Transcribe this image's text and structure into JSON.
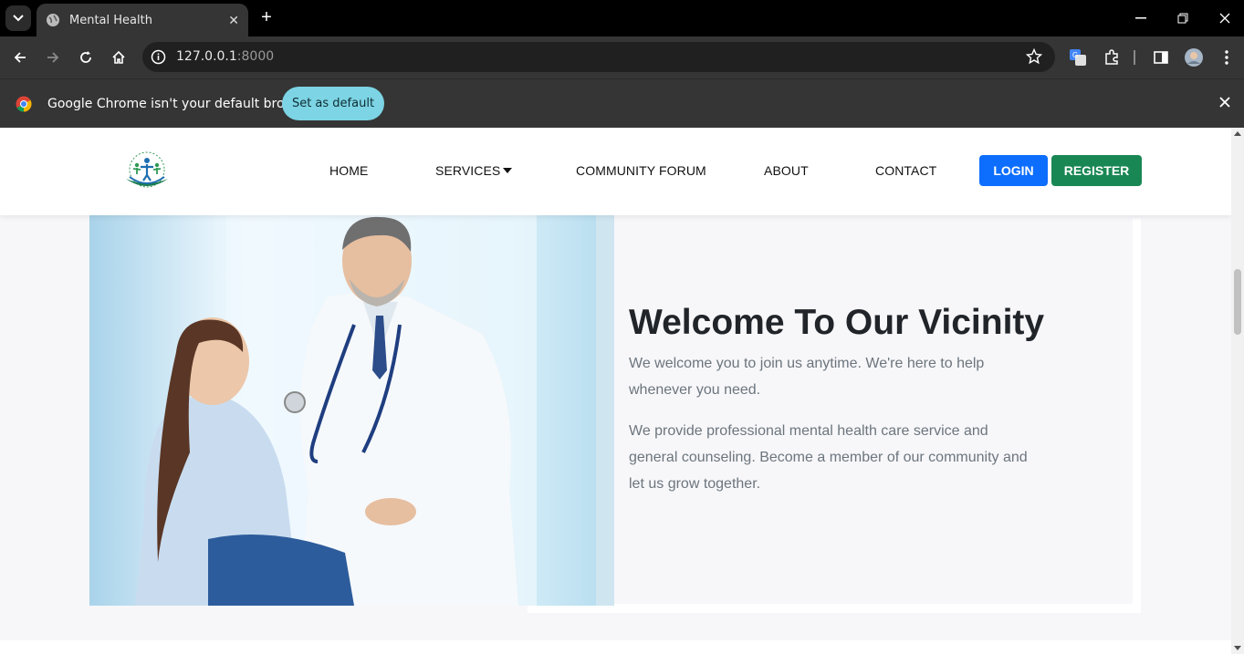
{
  "browser": {
    "tab_title": "Mental Health",
    "url_host": "127.0.0.1",
    "url_port": ":8000",
    "infobar_message": "Google Chrome isn't your default browser",
    "infobar_button": "Set as default"
  },
  "site": {
    "nav": {
      "home": "HOME",
      "services": "SERVICES",
      "community": "COMMUNITY FORUM",
      "about": "ABOUT",
      "contact": "CONTACT",
      "login": "LOGIN",
      "register": "REGISTER"
    },
    "hero": {
      "title": "Welcome To Our Vicinity",
      "paragraph1": "We welcome you to join us anytime. We're here to help whenever you need.",
      "paragraph2": "We provide professional mental health care service and general counseling. Become a member of our community and let us grow together."
    }
  },
  "colors": {
    "login": "#0d6efd",
    "register": "#198754",
    "set_default": "#7cd4e4"
  },
  "icons": [
    "tab-search-icon",
    "globe-icon",
    "close-icon",
    "plus-icon",
    "minimize-icon",
    "restore-icon",
    "back-icon",
    "forward-icon",
    "reload-icon",
    "home-icon",
    "info-icon",
    "star-icon",
    "translate-icon",
    "extensions-icon",
    "sidepanel-icon",
    "profile-avatar",
    "menu-icon",
    "chrome-logo"
  ]
}
